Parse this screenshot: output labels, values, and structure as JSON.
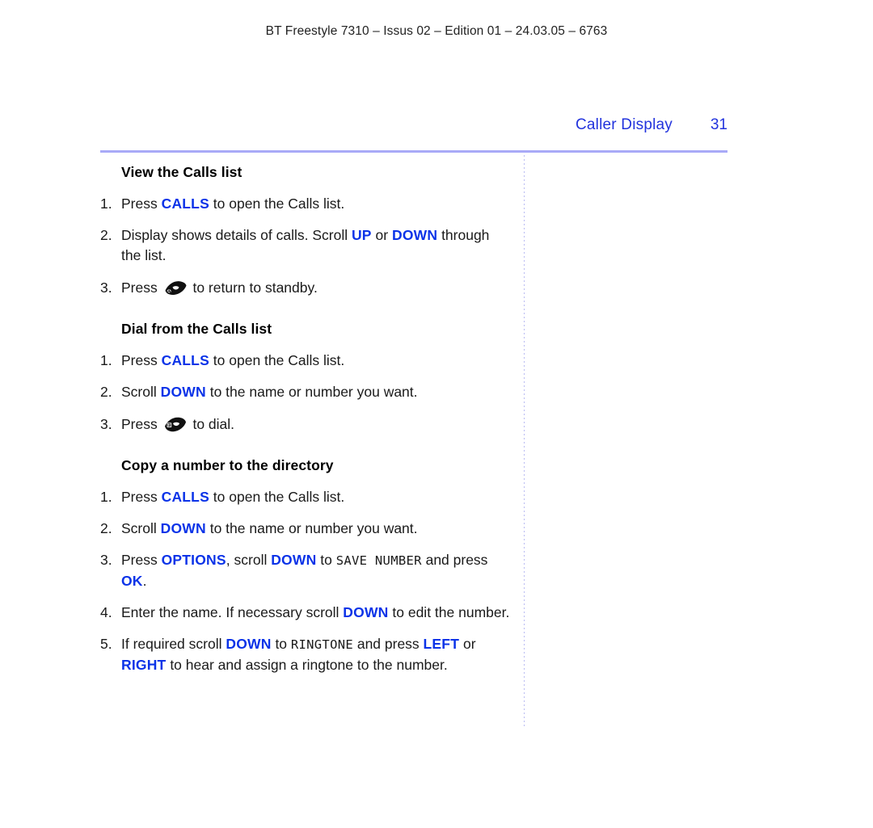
{
  "running_head": "BT Freestyle 7310 – Issus 02 – Edition 01 – 24.03.05 – 6763",
  "page_header": {
    "chapter_title": "Caller Display",
    "page_number": "31"
  },
  "colors": {
    "keyword_blue": "#0b33e8",
    "header_blue": "#2233dd",
    "rule_lavender": "#a9aaf7",
    "divider_lavender": "#b9bbf2",
    "body_text": "#1a1a1a"
  },
  "sections": [
    {
      "heading": "View the Calls list",
      "steps": [
        {
          "parts": [
            {
              "t": "plain",
              "text": "Press "
            },
            {
              "t": "kw",
              "text": "CALLS"
            },
            {
              "t": "plain",
              "text": " to open the Calls list."
            }
          ]
        },
        {
          "parts": [
            {
              "t": "plain",
              "text": "Display shows details of calls. Scroll "
            },
            {
              "t": "kw",
              "text": "UP"
            },
            {
              "t": "plain",
              "text": " or "
            },
            {
              "t": "kw",
              "text": "DOWN"
            },
            {
              "t": "plain",
              "text": " through the list."
            }
          ]
        },
        {
          "parts": [
            {
              "t": "plain",
              "text": "Press "
            },
            {
              "t": "icon",
              "icon": "end-call-key-icon"
            },
            {
              "t": "plain",
              "text": " to return to standby."
            }
          ]
        }
      ]
    },
    {
      "heading": "Dial from the Calls list",
      "steps": [
        {
          "parts": [
            {
              "t": "plain",
              "text": "Press "
            },
            {
              "t": "kw",
              "text": "CALLS"
            },
            {
              "t": "plain",
              "text": " to open the Calls list."
            }
          ]
        },
        {
          "parts": [
            {
              "t": "plain",
              "text": "Scroll "
            },
            {
              "t": "kw",
              "text": "DOWN"
            },
            {
              "t": "plain",
              "text": " to the name or number you want."
            }
          ]
        },
        {
          "parts": [
            {
              "t": "plain",
              "text": "Press "
            },
            {
              "t": "icon",
              "icon": "dial-key-icon"
            },
            {
              "t": "plain",
              "text": " to dial."
            }
          ]
        }
      ]
    },
    {
      "heading": "Copy a number to the directory",
      "steps": [
        {
          "parts": [
            {
              "t": "plain",
              "text": "Press "
            },
            {
              "t": "kw",
              "text": "CALLS"
            },
            {
              "t": "plain",
              "text": " to open the Calls list."
            }
          ]
        },
        {
          "parts": [
            {
              "t": "plain",
              "text": "Scroll "
            },
            {
              "t": "kw",
              "text": "DOWN"
            },
            {
              "t": "plain",
              "text": " to the name or number you want."
            }
          ]
        },
        {
          "parts": [
            {
              "t": "plain",
              "text": "Press "
            },
            {
              "t": "kw",
              "text": "OPTIONS"
            },
            {
              "t": "plain",
              "text": ", scroll "
            },
            {
              "t": "kw",
              "text": "DOWN"
            },
            {
              "t": "plain",
              "text": " to "
            },
            {
              "t": "lcd",
              "text": "SAVE NUMBER"
            },
            {
              "t": "plain",
              "text": " and press "
            },
            {
              "t": "kw",
              "text": "OK"
            },
            {
              "t": "plain",
              "text": "."
            }
          ]
        },
        {
          "parts": [
            {
              "t": "plain",
              "text": "Enter the name. If necessary scroll "
            },
            {
              "t": "kw",
              "text": "DOWN"
            },
            {
              "t": "plain",
              "text": " to edit the number."
            }
          ]
        },
        {
          "parts": [
            {
              "t": "plain",
              "text": "If required scroll "
            },
            {
              "t": "kw",
              "text": "DOWN"
            },
            {
              "t": "plain",
              "text": " to "
            },
            {
              "t": "lcd",
              "text": "RINGTONE"
            },
            {
              "t": "plain",
              "text": " and press "
            },
            {
              "t": "kw",
              "text": "LEFT"
            },
            {
              "t": "plain",
              "text": " or "
            },
            {
              "t": "kw",
              "text": "RIGHT"
            },
            {
              "t": "plain",
              "text": " to hear and assign a ringtone to the number."
            }
          ]
        }
      ]
    }
  ]
}
